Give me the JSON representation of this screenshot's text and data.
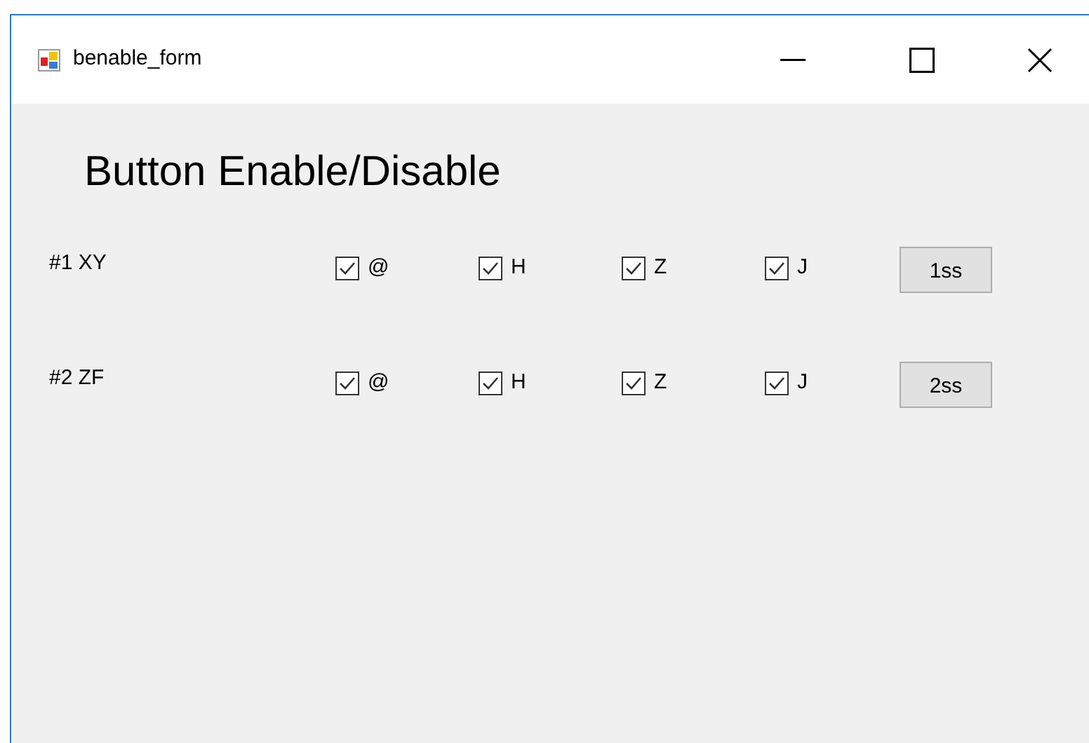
{
  "window": {
    "title": "benable_form"
  },
  "heading": "Button Enable/Disable",
  "rows": [
    {
      "label": "#1 XY",
      "checkboxes": [
        {
          "label": "@",
          "checked": true
        },
        {
          "label": "H",
          "checked": true
        },
        {
          "label": "Z",
          "checked": true
        },
        {
          "label": "J",
          "checked": true
        }
      ],
      "button": "1ss"
    },
    {
      "label": "#2 ZF",
      "checkboxes": [
        {
          "label": "@",
          "checked": true
        },
        {
          "label": "H",
          "checked": true
        },
        {
          "label": "Z",
          "checked": true
        },
        {
          "label": "J",
          "checked": true
        }
      ],
      "button": "2ss"
    }
  ]
}
